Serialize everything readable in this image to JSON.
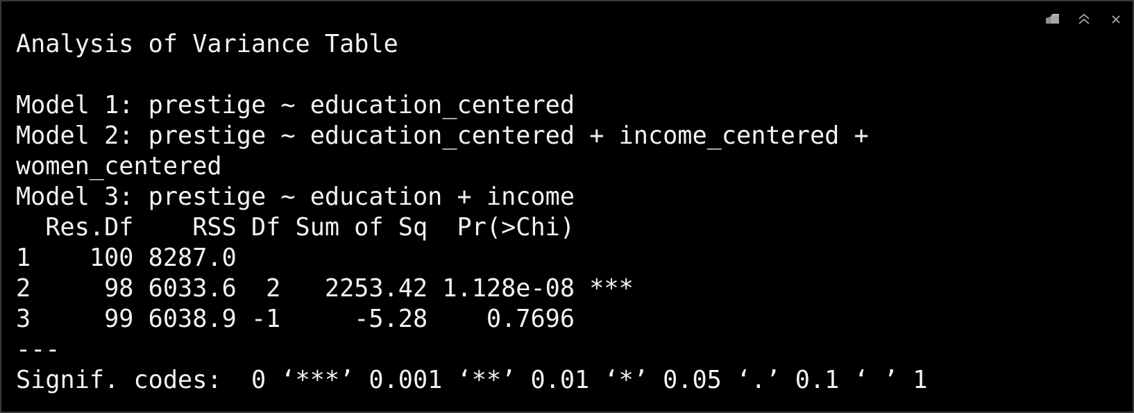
{
  "controls": [
    {
      "name": "clear-console-icon",
      "icon": "broom-icon"
    },
    {
      "name": "collapse-pane-icon",
      "icon": "double-chevron-up-icon"
    },
    {
      "name": "close-pane-icon",
      "icon": "close-icon"
    }
  ],
  "output": {
    "lines": [
      "Analysis of Variance Table",
      "",
      "Model 1: prestige ~ education_centered",
      "Model 2: prestige ~ education_centered + income_centered +",
      "women_centered",
      "Model 3: prestige ~ education + income",
      "  Res.Df    RSS Df Sum of Sq  Pr(>Chi)",
      "1    100 8287.0",
      "2     98 6033.6  2   2253.42 1.128e-08 ***",
      "3     99 6038.9 -1     -5.28    0.7696",
      "---",
      "Signif. codes:  0 ‘***’ 0.001 ‘**’ 0.01 ‘*’ 0.05 ‘.’ 0.1 ‘ ’ 1"
    ]
  },
  "colors": {
    "background": "#000000",
    "text": "#f2f2f2",
    "icon": "#9a9a9a"
  }
}
